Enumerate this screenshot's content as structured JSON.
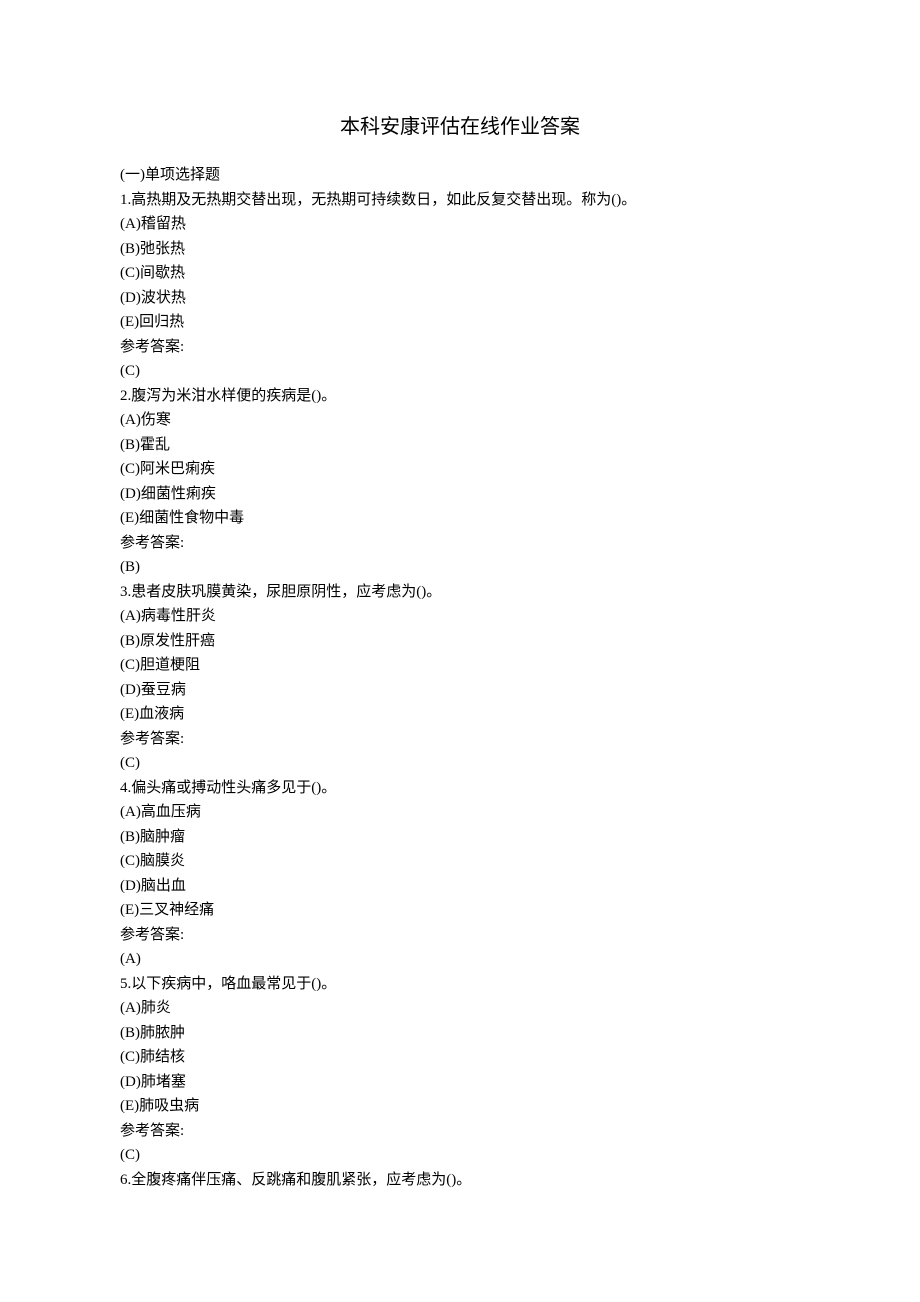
{
  "title": "本科安康评估在线作业答案",
  "section_heading": "(一)单项选择题",
  "questions": [
    {
      "stem": "1.高热期及无热期交替出现，无热期可持续数日，如此反复交替出现。称为()。",
      "options": [
        "(A)稽留热",
        "(B)弛张热",
        "(C)间歇热",
        "(D)波状热",
        "(E)回归热"
      ],
      "answer_label": "参考答案:",
      "answer": "(C)"
    },
    {
      "stem": "2.腹泻为米泔水样便的疾病是()。",
      "options": [
        "(A)伤寒",
        "(B)霍乱",
        "(C)阿米巴痢疾",
        "(D)细菌性痢疾",
        "(E)细菌性食物中毒"
      ],
      "answer_label": "参考答案:",
      "answer": "(B)"
    },
    {
      "stem": "3.患者皮肤巩膜黄染，尿胆原阴性，应考虑为()。",
      "options": [
        "(A)病毒性肝炎",
        "(B)原发性肝癌",
        "(C)胆道梗阻",
        "(D)蚕豆病",
        "(E)血液病"
      ],
      "answer_label": "参考答案:",
      "answer": "(C)"
    },
    {
      "stem": "4.偏头痛或搏动性头痛多见于()。",
      "options": [
        "(A)高血压病",
        "(B)脑肿瘤",
        "(C)脑膜炎",
        "(D)脑出血",
        "(E)三叉神经痛"
      ],
      "answer_label": "参考答案:",
      "answer": "(A)"
    },
    {
      "stem": "5.以下疾病中，咯血最常见于()。",
      "options": [
        "(A)肺炎",
        "(B)肺脓肿",
        "(C)肺结核",
        "(D)肺堵塞",
        "(E)肺吸虫病"
      ],
      "answer_label": "参考答案:",
      "answer": "(C)"
    },
    {
      "stem": "6.全腹疼痛伴压痛、反跳痛和腹肌紧张，应考虑为()。",
      "options": [],
      "answer_label": "",
      "answer": ""
    }
  ]
}
